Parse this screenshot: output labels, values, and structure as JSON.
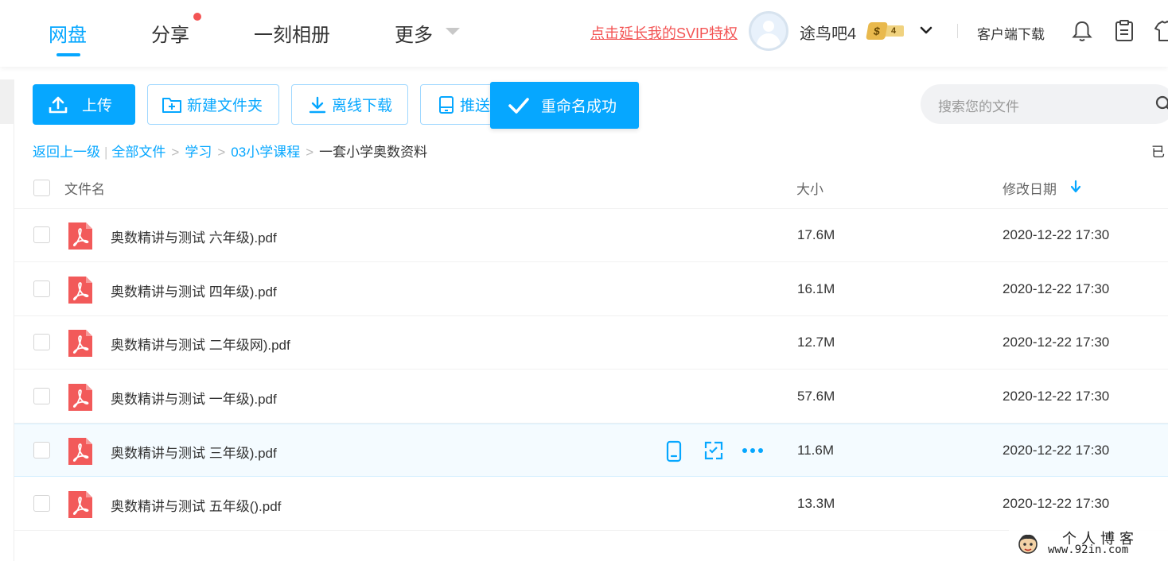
{
  "nav": {
    "items": [
      "网盘",
      "分享",
      "一刻相册",
      "更多"
    ],
    "active_index": 0,
    "svip_link": "点击延长我的SVIP特权",
    "username": "途鸟吧4",
    "badge_symbol": "$",
    "badge_level": "4",
    "client_download": "客户端下载"
  },
  "toolbar": {
    "upload": "上传",
    "new_folder": "新建文件夹",
    "offline_download": "离线下载",
    "push": "推送"
  },
  "toast": {
    "message": "重命名成功"
  },
  "search": {
    "placeholder": "搜索您的文件"
  },
  "breadcrumb": {
    "back": "返回上一级",
    "items": [
      "全部文件",
      "学习",
      "03小学课程"
    ],
    "current": "一套小学奥数资料",
    "separator": ">",
    "loaded_text": "已"
  },
  "table": {
    "columns": {
      "name": "文件名",
      "size": "大小",
      "modified": "修改日期"
    },
    "sort": "desc",
    "rows": [
      {
        "name": "奥数精讲与测试 六年级).pdf",
        "size": "17.6M",
        "modified": "2020-12-22 17:30"
      },
      {
        "name": "奥数精讲与测试 四年级).pdf",
        "size": "16.1M",
        "modified": "2020-12-22 17:30"
      },
      {
        "name": "奥数精讲与测试 二年级网).pdf",
        "size": "12.7M",
        "modified": "2020-12-22 17:30"
      },
      {
        "name": "奥数精讲与测试 一年级).pdf",
        "size": "57.6M",
        "modified": "2020-12-22 17:30"
      },
      {
        "name": "奥数精讲与测试 三年级).pdf",
        "size": "11.6M",
        "modified": "2020-12-22 17:30"
      },
      {
        "name": "奥数精讲与测试 五年级().pdf",
        "size": "13.3M",
        "modified": "2020-12-22 17:30"
      }
    ],
    "hover_row_index": 4,
    "hover_actions": [
      "phone-icon",
      "share-icon",
      "more-icon"
    ]
  },
  "watermark": {
    "line1": "个人博客",
    "line2": "www.92in.com"
  },
  "colors": {
    "accent": "#06a7ff",
    "notice_red": "#f35454",
    "pdf_red": "#f25a5a",
    "hover_row": "#f4fbff"
  }
}
